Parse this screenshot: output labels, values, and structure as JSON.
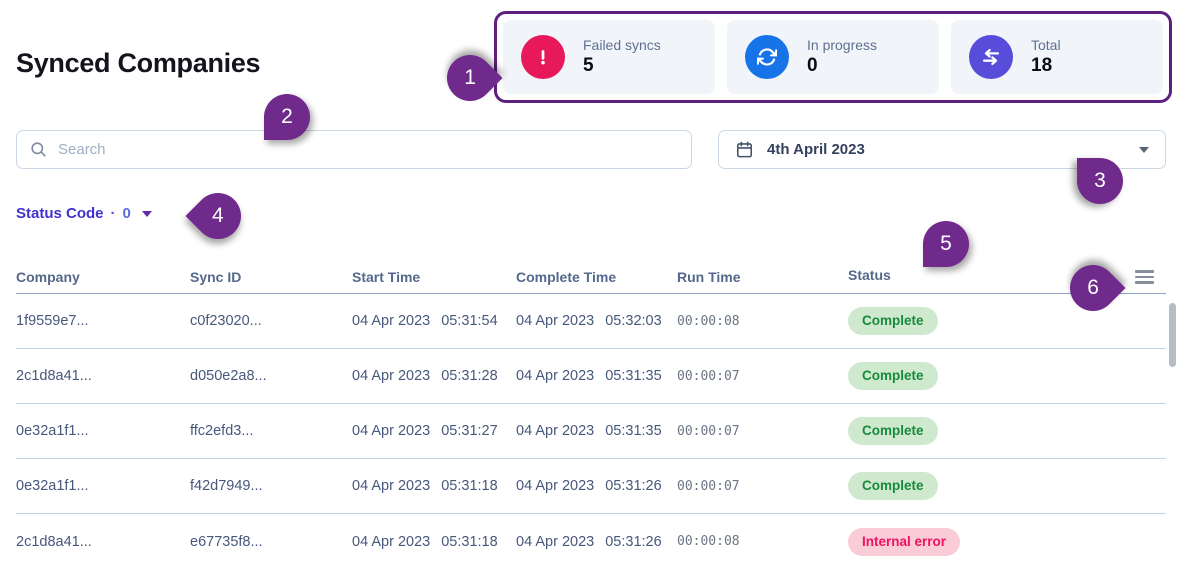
{
  "page": {
    "title": "Synced Companies"
  },
  "stats": {
    "cards": [
      {
        "icon": "alert-icon",
        "label": "Failed syncs",
        "value": "5",
        "color": "#e8185d"
      },
      {
        "icon": "sync-icon",
        "label": "In progress",
        "value": "0",
        "color": "#1674e8"
      },
      {
        "icon": "transfer-arrows-icon",
        "label": "Total",
        "value": "18",
        "color": "#584ddb"
      }
    ]
  },
  "search": {
    "placeholder": "Search",
    "value": "",
    "icon": "search-icon"
  },
  "date_picker": {
    "value": "4th April 2023",
    "icon": "calendar-icon",
    "caret": "caret-down-icon"
  },
  "filter": {
    "label": "Status Code",
    "separator": "·",
    "count": "0",
    "caret": "caret-down-icon"
  },
  "table": {
    "columns": [
      "Company",
      "Sync ID",
      "Start Time",
      "Complete Time",
      "Run Time",
      "Status"
    ],
    "menu_icon": "menu-icon",
    "rows": [
      {
        "company": "1f9559e7...",
        "sync_id": "c0f23020...",
        "start_date": "04 Apr 2023",
        "start_time": "05:31:54",
        "complete_date": "04 Apr 2023",
        "complete_time": "05:32:03",
        "run_time": "00:00:08",
        "status": "Complete",
        "status_type": "success"
      },
      {
        "company": "2c1d8a41...",
        "sync_id": "d050e2a8...",
        "start_date": "04 Apr 2023",
        "start_time": "05:31:28",
        "complete_date": "04 Apr 2023",
        "complete_time": "05:31:35",
        "run_time": "00:00:07",
        "status": "Complete",
        "status_type": "success"
      },
      {
        "company": "0e32a1f1...",
        "sync_id": "ffc2efd3...",
        "start_date": "04 Apr 2023",
        "start_time": "05:31:27",
        "complete_date": "04 Apr 2023",
        "complete_time": "05:31:35",
        "run_time": "00:00:07",
        "status": "Complete",
        "status_type": "success"
      },
      {
        "company": "0e32a1f1...",
        "sync_id": "f42d7949...",
        "start_date": "04 Apr 2023",
        "start_time": "05:31:18",
        "complete_date": "04 Apr 2023",
        "complete_time": "05:31:26",
        "run_time": "00:00:07",
        "status": "Complete",
        "status_type": "success"
      },
      {
        "company": "2c1d8a41...",
        "sync_id": "e67735f8...",
        "start_date": "04 Apr 2023",
        "start_time": "05:31:18",
        "complete_date": "04 Apr 2023",
        "complete_time": "05:31:26",
        "run_time": "00:00:08",
        "status": "Internal error",
        "status_type": "error"
      }
    ]
  },
  "annotations": [
    "1",
    "2",
    "3",
    "4",
    "5",
    "6"
  ],
  "colors": {
    "annotation_purple": "#6f2a8c",
    "annotation_border": "#5e2080",
    "failed_icon": "#e8185d",
    "progress_icon": "#1674e8",
    "total_icon": "#584ddb",
    "badge_success_bg": "#cfe9cf",
    "badge_success_text": "#188a3c",
    "badge_error_bg": "#f9ccd8",
    "badge_error_text": "#f2115f",
    "filter_link": "#4132cf",
    "card_bg": "#f1f5f9"
  }
}
